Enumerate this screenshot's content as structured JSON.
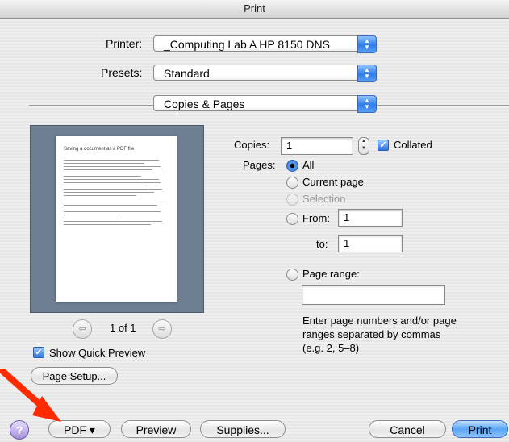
{
  "window": {
    "title": "Print"
  },
  "printer": {
    "label": "Printer:",
    "value": "_Computing Lab A HP 8150 DNS"
  },
  "presets": {
    "label": "Presets:",
    "value": "Standard"
  },
  "pane": {
    "value": "Copies & Pages"
  },
  "preview": {
    "doc_title": "Saving a document as a PDF file",
    "page_indicator": "1 of 1",
    "quick_preview_label": "Show Quick Preview",
    "quick_preview_checked": true,
    "page_setup_label": "Page Setup..."
  },
  "copies": {
    "label": "Copies:",
    "value": "1",
    "collated_label": "Collated",
    "collated_checked": true
  },
  "pages": {
    "label": "Pages:",
    "all": "All",
    "current": "Current page",
    "selection": "Selection",
    "from_label": "From:",
    "from_value": "1",
    "to_label": "to:",
    "to_value": "1",
    "range_label": "Page range:",
    "range_value": "",
    "hint": "Enter page numbers and/or page ranges separated by commas (e.g. 2, 5–8)"
  },
  "bottom": {
    "help": "?",
    "pdf": "PDF ▾",
    "preview": "Preview",
    "supplies": "Supplies...",
    "cancel": "Cancel",
    "print": "Print"
  },
  "colors": {
    "accent": "#2e7de6",
    "annotation_arrow": "#ff2a00"
  }
}
